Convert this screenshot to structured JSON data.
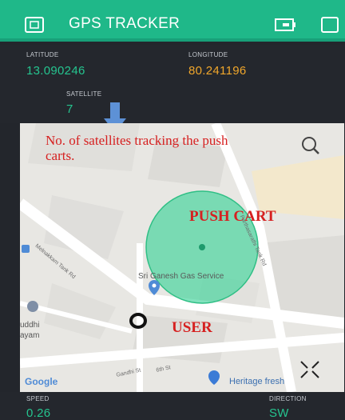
{
  "header": {
    "title": "GPS TRACKER",
    "left_icon": "tablet-icon",
    "right_icons": [
      "battery-icon",
      "square-icon"
    ]
  },
  "readings": {
    "latitude": {
      "label": "LATITUDE",
      "value": "13.090246",
      "color": "#25c48f"
    },
    "longitude": {
      "label": "LONGITUDE",
      "value": "80.241196",
      "color": "#f0a62b"
    },
    "satellite": {
      "label": "SATELLITE",
      "value": "7",
      "color": "#25c48f"
    },
    "speed": {
      "label": "SPEED",
      "value": "0.26",
      "color": "#25c48f"
    },
    "direction": {
      "label": "DIRECTION",
      "value": "SW",
      "color": "#25c48f"
    }
  },
  "map": {
    "place_name": "Sri Ganesh Gas Service",
    "roads": [
      "Melnakkam Tank Rd",
      "Gandhi St",
      "Parthasarathi Tank Rd",
      "6th St"
    ],
    "partial_place": [
      "uddhi",
      "ayam"
    ],
    "poi": "Heritage fresh",
    "brand": "Google"
  },
  "annotations": {
    "satellites_note": "No. of satellites tracking the push carts.",
    "push_cart": "PUSH CART",
    "user": "USER"
  },
  "colors": {
    "header_bg": "#1fb889",
    "panel_bg": "#24272d",
    "annotation": "#d62020",
    "cart_circle": "#3ed39a",
    "arrow": "#5d91d6"
  }
}
